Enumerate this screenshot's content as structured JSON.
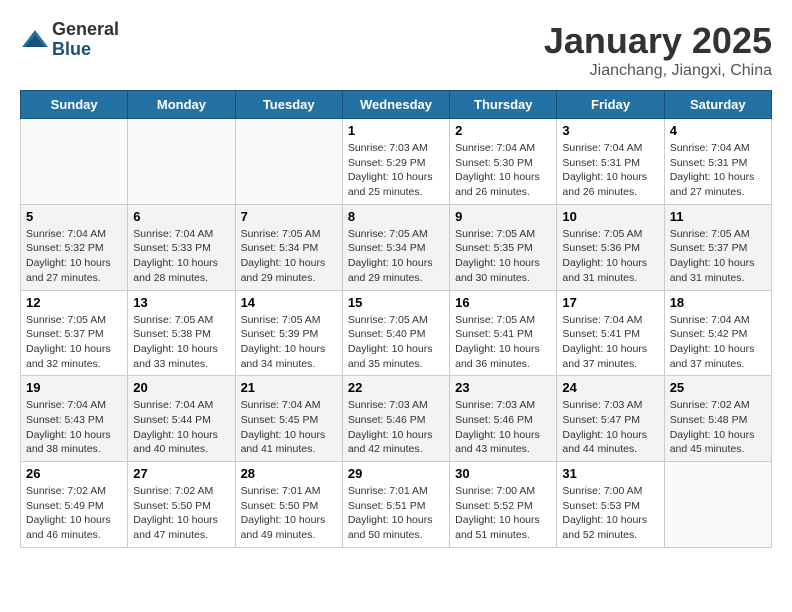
{
  "header": {
    "logo_general": "General",
    "logo_blue": "Blue",
    "month_title": "January 2025",
    "subtitle": "Jianchang, Jiangxi, China"
  },
  "days_of_week": [
    "Sunday",
    "Monday",
    "Tuesday",
    "Wednesday",
    "Thursday",
    "Friday",
    "Saturday"
  ],
  "weeks": [
    {
      "shaded": false,
      "days": [
        {
          "num": "",
          "info": ""
        },
        {
          "num": "",
          "info": ""
        },
        {
          "num": "",
          "info": ""
        },
        {
          "num": "1",
          "info": "Sunrise: 7:03 AM\nSunset: 5:29 PM\nDaylight: 10 hours\nand 25 minutes."
        },
        {
          "num": "2",
          "info": "Sunrise: 7:04 AM\nSunset: 5:30 PM\nDaylight: 10 hours\nand 26 minutes."
        },
        {
          "num": "3",
          "info": "Sunrise: 7:04 AM\nSunset: 5:31 PM\nDaylight: 10 hours\nand 26 minutes."
        },
        {
          "num": "4",
          "info": "Sunrise: 7:04 AM\nSunset: 5:31 PM\nDaylight: 10 hours\nand 27 minutes."
        }
      ]
    },
    {
      "shaded": true,
      "days": [
        {
          "num": "5",
          "info": "Sunrise: 7:04 AM\nSunset: 5:32 PM\nDaylight: 10 hours\nand 27 minutes."
        },
        {
          "num": "6",
          "info": "Sunrise: 7:04 AM\nSunset: 5:33 PM\nDaylight: 10 hours\nand 28 minutes."
        },
        {
          "num": "7",
          "info": "Sunrise: 7:05 AM\nSunset: 5:34 PM\nDaylight: 10 hours\nand 29 minutes."
        },
        {
          "num": "8",
          "info": "Sunrise: 7:05 AM\nSunset: 5:34 PM\nDaylight: 10 hours\nand 29 minutes."
        },
        {
          "num": "9",
          "info": "Sunrise: 7:05 AM\nSunset: 5:35 PM\nDaylight: 10 hours\nand 30 minutes."
        },
        {
          "num": "10",
          "info": "Sunrise: 7:05 AM\nSunset: 5:36 PM\nDaylight: 10 hours\nand 31 minutes."
        },
        {
          "num": "11",
          "info": "Sunrise: 7:05 AM\nSunset: 5:37 PM\nDaylight: 10 hours\nand 31 minutes."
        }
      ]
    },
    {
      "shaded": false,
      "days": [
        {
          "num": "12",
          "info": "Sunrise: 7:05 AM\nSunset: 5:37 PM\nDaylight: 10 hours\nand 32 minutes."
        },
        {
          "num": "13",
          "info": "Sunrise: 7:05 AM\nSunset: 5:38 PM\nDaylight: 10 hours\nand 33 minutes."
        },
        {
          "num": "14",
          "info": "Sunrise: 7:05 AM\nSunset: 5:39 PM\nDaylight: 10 hours\nand 34 minutes."
        },
        {
          "num": "15",
          "info": "Sunrise: 7:05 AM\nSunset: 5:40 PM\nDaylight: 10 hours\nand 35 minutes."
        },
        {
          "num": "16",
          "info": "Sunrise: 7:05 AM\nSunset: 5:41 PM\nDaylight: 10 hours\nand 36 minutes."
        },
        {
          "num": "17",
          "info": "Sunrise: 7:04 AM\nSunset: 5:41 PM\nDaylight: 10 hours\nand 37 minutes."
        },
        {
          "num": "18",
          "info": "Sunrise: 7:04 AM\nSunset: 5:42 PM\nDaylight: 10 hours\nand 37 minutes."
        }
      ]
    },
    {
      "shaded": true,
      "days": [
        {
          "num": "19",
          "info": "Sunrise: 7:04 AM\nSunset: 5:43 PM\nDaylight: 10 hours\nand 38 minutes."
        },
        {
          "num": "20",
          "info": "Sunrise: 7:04 AM\nSunset: 5:44 PM\nDaylight: 10 hours\nand 40 minutes."
        },
        {
          "num": "21",
          "info": "Sunrise: 7:04 AM\nSunset: 5:45 PM\nDaylight: 10 hours\nand 41 minutes."
        },
        {
          "num": "22",
          "info": "Sunrise: 7:03 AM\nSunset: 5:46 PM\nDaylight: 10 hours\nand 42 minutes."
        },
        {
          "num": "23",
          "info": "Sunrise: 7:03 AM\nSunset: 5:46 PM\nDaylight: 10 hours\nand 43 minutes."
        },
        {
          "num": "24",
          "info": "Sunrise: 7:03 AM\nSunset: 5:47 PM\nDaylight: 10 hours\nand 44 minutes."
        },
        {
          "num": "25",
          "info": "Sunrise: 7:02 AM\nSunset: 5:48 PM\nDaylight: 10 hours\nand 45 minutes."
        }
      ]
    },
    {
      "shaded": false,
      "days": [
        {
          "num": "26",
          "info": "Sunrise: 7:02 AM\nSunset: 5:49 PM\nDaylight: 10 hours\nand 46 minutes."
        },
        {
          "num": "27",
          "info": "Sunrise: 7:02 AM\nSunset: 5:50 PM\nDaylight: 10 hours\nand 47 minutes."
        },
        {
          "num": "28",
          "info": "Sunrise: 7:01 AM\nSunset: 5:50 PM\nDaylight: 10 hours\nand 49 minutes."
        },
        {
          "num": "29",
          "info": "Sunrise: 7:01 AM\nSunset: 5:51 PM\nDaylight: 10 hours\nand 50 minutes."
        },
        {
          "num": "30",
          "info": "Sunrise: 7:00 AM\nSunset: 5:52 PM\nDaylight: 10 hours\nand 51 minutes."
        },
        {
          "num": "31",
          "info": "Sunrise: 7:00 AM\nSunset: 5:53 PM\nDaylight: 10 hours\nand 52 minutes."
        },
        {
          "num": "",
          "info": ""
        }
      ]
    }
  ]
}
